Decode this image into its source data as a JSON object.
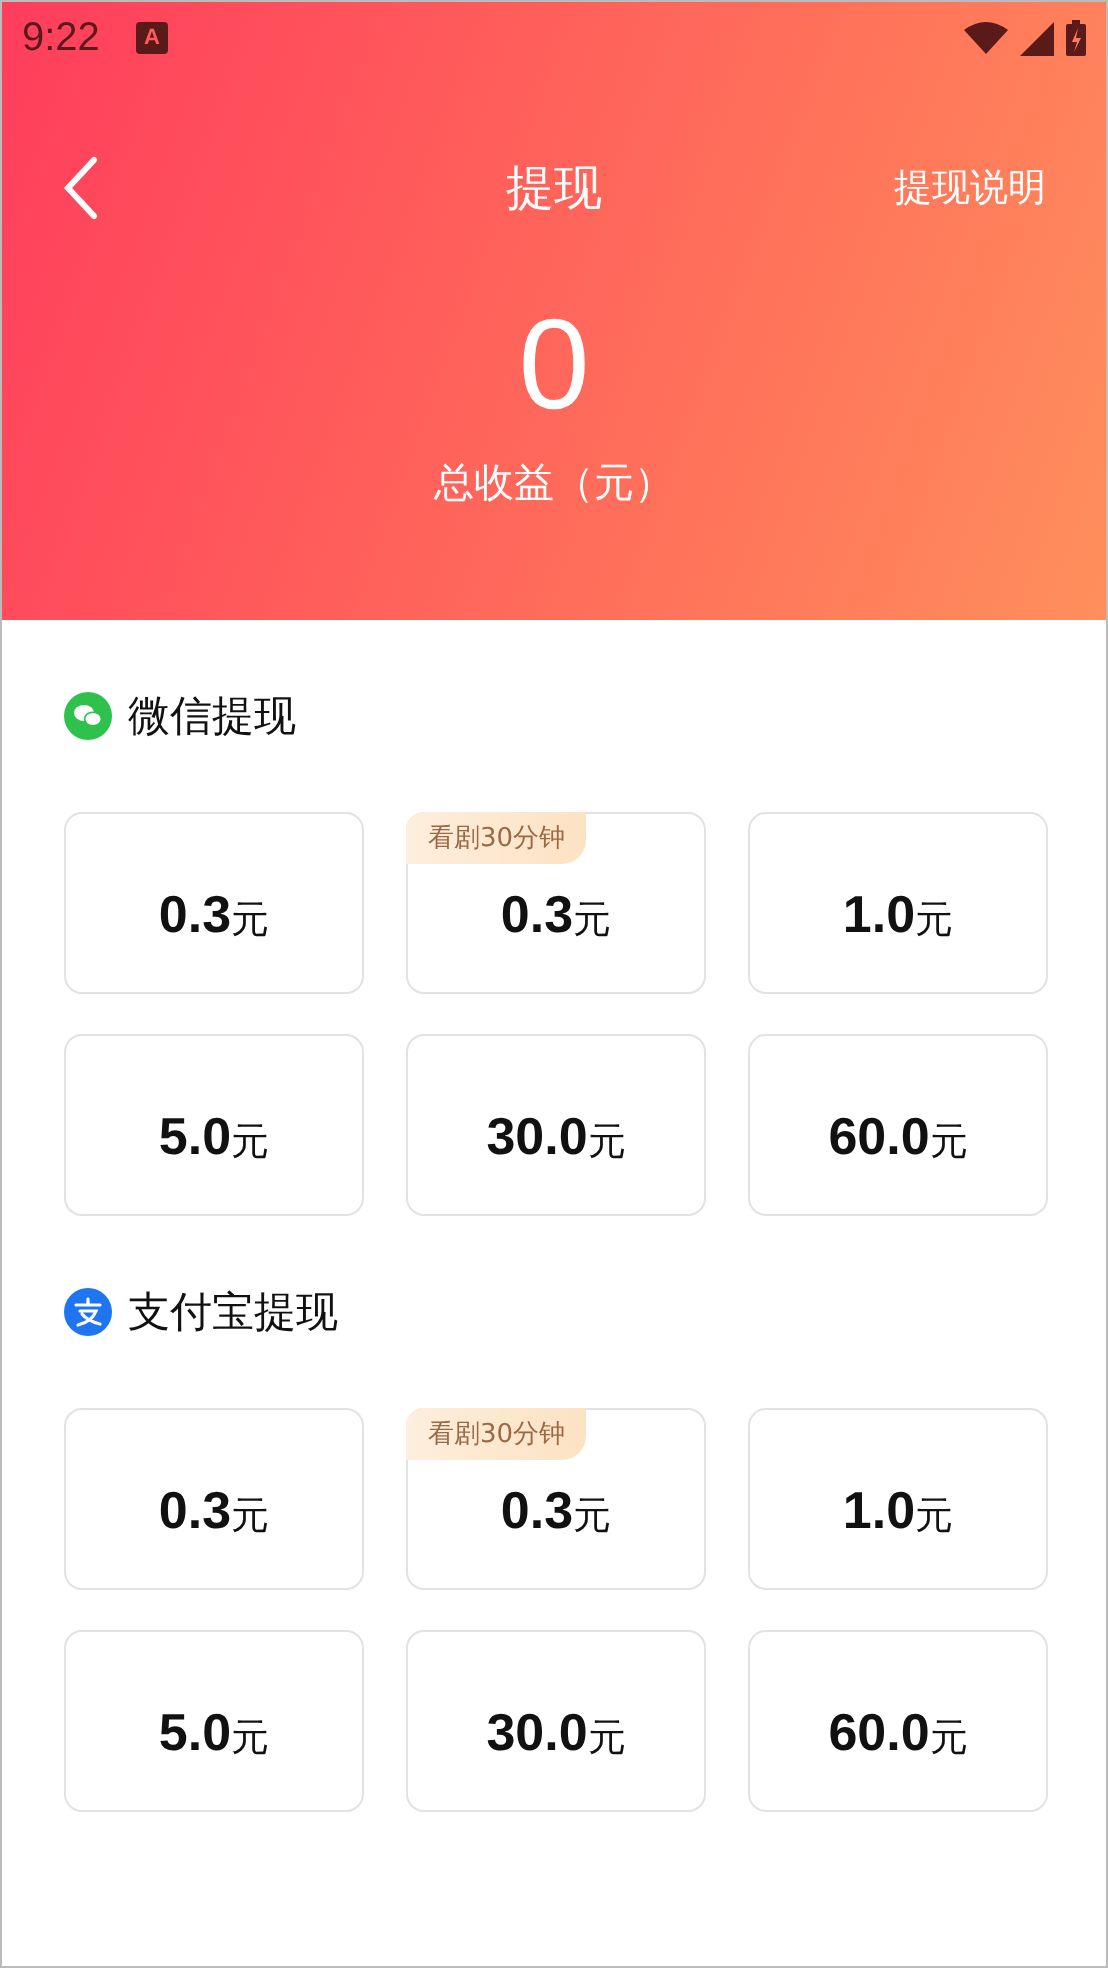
{
  "status_bar": {
    "time": "9:22",
    "app_badge": "A"
  },
  "nav": {
    "title": "提现",
    "action": "提现说明"
  },
  "summary": {
    "amount": "0",
    "label": "总收益（元）"
  },
  "sections": [
    {
      "kind": "wechat",
      "title": "微信提现",
      "options": [
        {
          "amount": "0.3",
          "unit": "元"
        },
        {
          "amount": "0.3",
          "unit": "元",
          "tag": "看剧30分钟"
        },
        {
          "amount": "1.0",
          "unit": "元"
        },
        {
          "amount": "5.0",
          "unit": "元"
        },
        {
          "amount": "30.0",
          "unit": "元"
        },
        {
          "amount": "60.0",
          "unit": "元"
        }
      ]
    },
    {
      "kind": "alipay",
      "title": "支付宝提现",
      "options": [
        {
          "amount": "0.3",
          "unit": "元"
        },
        {
          "amount": "0.3",
          "unit": "元",
          "tag": "看剧30分钟"
        },
        {
          "amount": "1.0",
          "unit": "元"
        },
        {
          "amount": "5.0",
          "unit": "元"
        },
        {
          "amount": "30.0",
          "unit": "元"
        },
        {
          "amount": "60.0",
          "unit": "元"
        }
      ]
    }
  ]
}
